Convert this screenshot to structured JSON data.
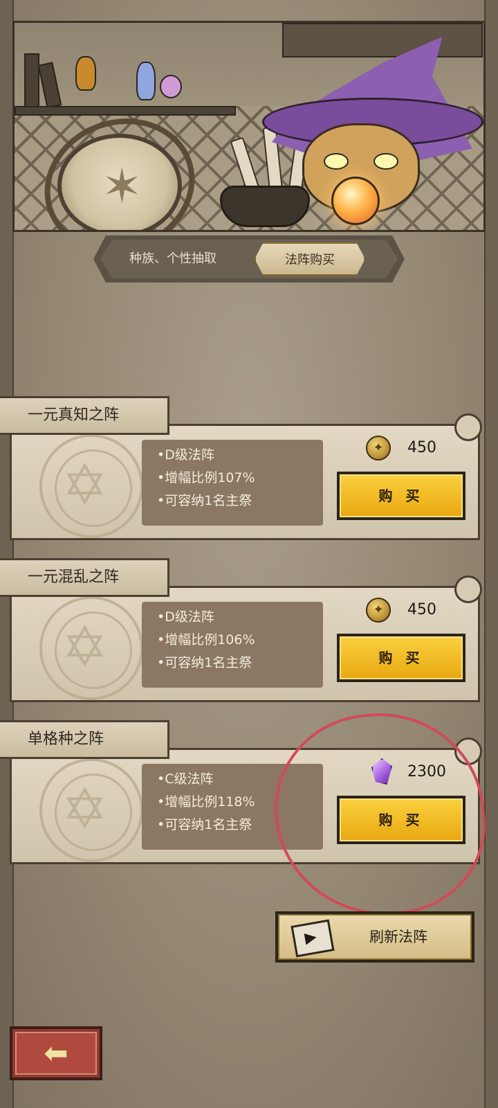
{
  "tabs": [
    {
      "label": "种族、个性抽取",
      "active": false
    },
    {
      "label": "法阵购买",
      "active": true
    }
  ],
  "cards": [
    {
      "title": "一元真知之阵",
      "lines": [
        "•D级法阵",
        "•增幅比例107%",
        "•可容纳1名主祭"
      ],
      "currency_icon": "gold-coin-icon",
      "price": "450",
      "buy_label": "购 买"
    },
    {
      "title": "一元混乱之阵",
      "lines": [
        "•D级法阵",
        "•增幅比例106%",
        "•可容纳1名主祭"
      ],
      "currency_icon": "gold-coin-icon",
      "price": "450",
      "buy_label": "购 买"
    },
    {
      "title": "单格种之阵",
      "lines": [
        "•C级法阵",
        "•增幅比例118%",
        "•可容纳1名主祭"
      ],
      "currency_icon": "purple-crystal-icon",
      "price": "2300",
      "buy_label": "购 买"
    }
  ],
  "refresh": {
    "label": "刷新法阵",
    "icon": "video-ad-icon"
  },
  "back": {
    "icon": "back-arrow-icon"
  },
  "colors": {
    "accent_gold": "#f2b82a",
    "panel_brown": "#8b7762",
    "highlight_red": "#d24a58",
    "hat_purple": "#8d5fb0"
  }
}
